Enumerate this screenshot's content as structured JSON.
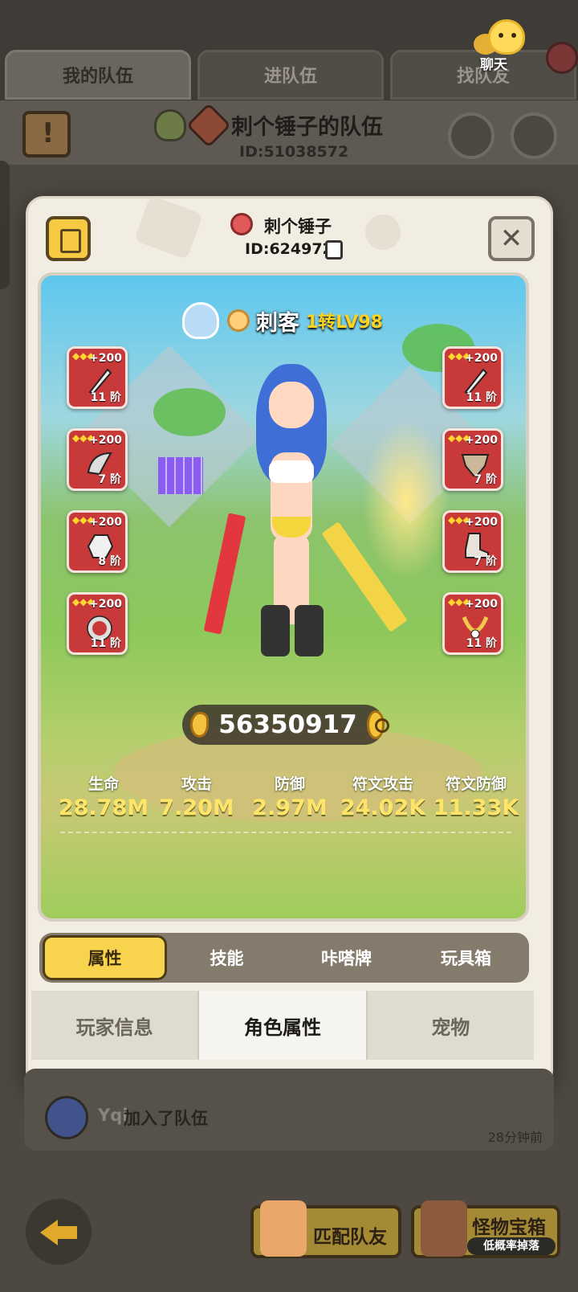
{
  "tabs": [
    "我的队伍",
    "进队伍",
    "找队友"
  ],
  "chat": {
    "label": "聊天"
  },
  "team": {
    "title": "刺个锤子的队伍",
    "id": "ID:51038572"
  },
  "profile": {
    "name": "刺个锤子",
    "id": "ID:624972",
    "class_name": "刺客",
    "level": "1转LV98",
    "power": "56350917"
  },
  "equipment_left": [
    {
      "plus": "+200",
      "tier": "11 阶",
      "icon": "spiked-blade-icon"
    },
    {
      "plus": "+200",
      "tier": "7 阶",
      "icon": "wing-shoulder-icon"
    },
    {
      "plus": "+200",
      "tier": "8 阶",
      "icon": "spiked-glove-icon"
    },
    {
      "plus": "+200",
      "tier": "11 阶",
      "icon": "spiked-ring-icon"
    }
  ],
  "equipment_right": [
    {
      "plus": "+200",
      "tier": "11 阶",
      "icon": "spiked-blade-icon"
    },
    {
      "plus": "+200",
      "tier": "7 阶",
      "icon": "armor-icon"
    },
    {
      "plus": "+200",
      "tier": "7 阶",
      "icon": "boot-icon"
    },
    {
      "plus": "+200",
      "tier": "11 阶",
      "icon": "necklace-icon"
    }
  ],
  "stats": [
    {
      "label": "生命",
      "value": "28.78M"
    },
    {
      "label": "攻击",
      "value": "7.20M"
    },
    {
      "label": "防御",
      "value": "2.97M"
    },
    {
      "label": "符文攻击",
      "value": "24.02K"
    },
    {
      "label": "符文防御",
      "value": "11.33K"
    }
  ],
  "sub_tabs": [
    "属性",
    "技能",
    "咔嗒牌",
    "玩具箱"
  ],
  "bottom_tabs": [
    "玩家信息",
    "角色属性",
    "宠物"
  ],
  "feed": {
    "name": "Yqi",
    "text": "加入了队伍",
    "time": "28分钟前"
  },
  "actions": {
    "match": "匹配队友",
    "chest": "怪物宝箱",
    "chest_sub": "低概率掉落"
  },
  "colors": {
    "accent": "#f8d34e",
    "equip_bg": "#c83a3a",
    "stat_value": "#ffe46a",
    "level": "#ffd21e"
  }
}
